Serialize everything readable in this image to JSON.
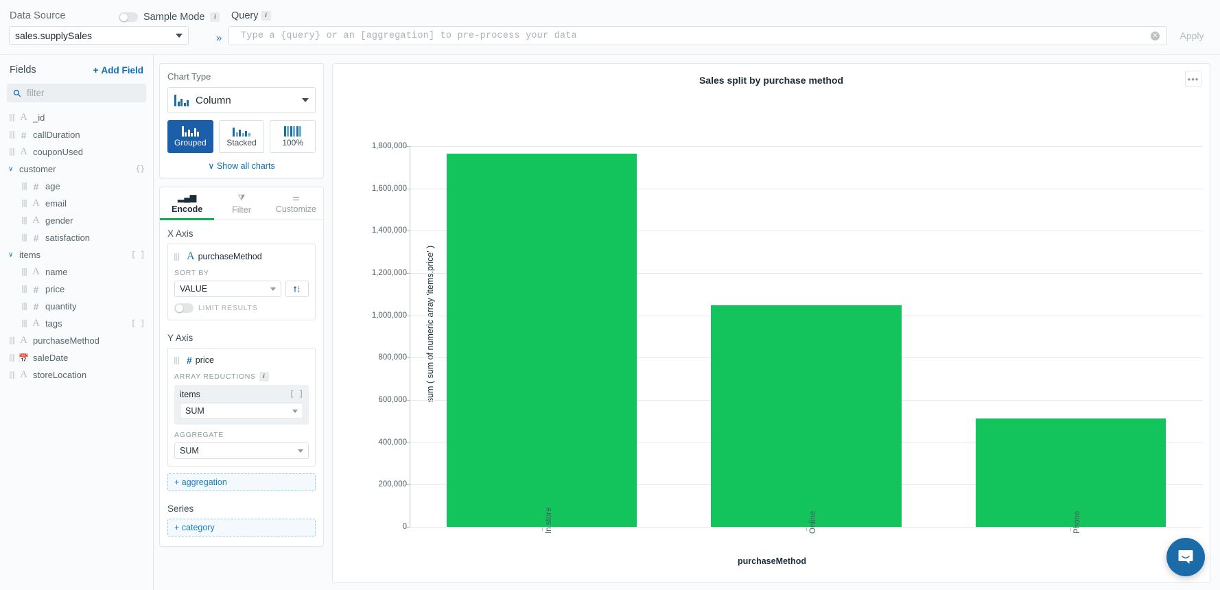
{
  "topbar": {
    "data_source_label": "Data Source",
    "sample_mode_label": "Sample Mode",
    "info_glyph": "i",
    "data_source_value": "sales.supplySales",
    "chevron_double": "»",
    "query_label": "Query",
    "query_value": "",
    "query_placeholder": "Type a {query} or an [aggregation] to pre-process your data",
    "clear_glyph": "✕",
    "apply_label": "Apply"
  },
  "sidebar": {
    "title": "Fields",
    "add_field_label": "Add Field",
    "add_field_plus": "+",
    "filter_placeholder": "filter",
    "search_glyph": "⚲",
    "fields": [
      {
        "name": "_id",
        "type": "A",
        "nested": false,
        "tag": ""
      },
      {
        "name": "callDuration",
        "type": "#",
        "nested": false,
        "tag": ""
      },
      {
        "name": "couponUsed",
        "type": "A",
        "nested": false,
        "tag": ""
      },
      {
        "name": "customer",
        "type": "group",
        "nested": false,
        "tag": "{}",
        "expanded": true
      },
      {
        "name": "age",
        "type": "#",
        "nested": true,
        "tag": ""
      },
      {
        "name": "email",
        "type": "A",
        "nested": true,
        "tag": ""
      },
      {
        "name": "gender",
        "type": "A",
        "nested": true,
        "tag": ""
      },
      {
        "name": "satisfaction",
        "type": "#",
        "nested": true,
        "tag": ""
      },
      {
        "name": "items",
        "type": "group",
        "nested": false,
        "tag": "[ ]",
        "expanded": true
      },
      {
        "name": "name",
        "type": "A",
        "nested": true,
        "tag": ""
      },
      {
        "name": "price",
        "type": "#",
        "nested": true,
        "tag": ""
      },
      {
        "name": "quantity",
        "type": "#",
        "nested": true,
        "tag": ""
      },
      {
        "name": "tags",
        "type": "A",
        "nested": true,
        "tag": "[ ]"
      },
      {
        "name": "purchaseMethod",
        "type": "A",
        "nested": false,
        "tag": ""
      },
      {
        "name": "saleDate",
        "type": "date",
        "nested": false,
        "tag": ""
      },
      {
        "name": "storeLocation",
        "type": "A",
        "nested": false,
        "tag": ""
      }
    ]
  },
  "chart_type_panel": {
    "title": "Chart Type",
    "selected_chart": "Column",
    "variants": [
      {
        "label": "Grouped",
        "active": true
      },
      {
        "label": "Stacked",
        "active": false
      },
      {
        "label": "100%",
        "active": false
      }
    ],
    "show_all_label": "Show all charts",
    "show_all_chevron": "∨"
  },
  "encode_panel": {
    "tabs": [
      {
        "label": "Encode",
        "icon": "bar-chart-icon",
        "active": true
      },
      {
        "label": "Filter",
        "icon": "funnel-icon",
        "active": false
      },
      {
        "label": "Customize",
        "icon": "sliders-icon",
        "active": false
      }
    ],
    "x_axis": {
      "heading": "X Axis",
      "field": "purchaseMethod",
      "field_type": "A",
      "sort_by_label": "SORT BY",
      "sort_by_value": "VALUE",
      "sort_direction_icon": "sort-asc-icon",
      "limit_results_label": "LIMIT RESULTS",
      "limit_results_on": false
    },
    "y_axis": {
      "heading": "Y Axis",
      "field": "price",
      "field_type": "#",
      "array_reductions_label": "ARRAY REDUCTIONS",
      "array_reduction_field": "items",
      "array_reduction_tag": "[ ]",
      "array_reduction_value": "SUM",
      "aggregate_label": "AGGREGATE",
      "aggregate_value": "SUM",
      "add_aggregation_label": "+ aggregation"
    },
    "series": {
      "heading": "Series",
      "add_category_label": "+ category"
    }
  },
  "chart_panel": {
    "menu_glyph": "•••",
    "chat_icon": "chat-bubble-icon"
  },
  "chart_data": {
    "type": "bar",
    "title": "Sales split by purchase method",
    "categories": [
      "In store",
      "Online",
      "Phone"
    ],
    "values": [
      1765000,
      1048000,
      512000
    ],
    "series": [
      {
        "name": "sum ( sum of numeric array 'items.price' )",
        "values": [
          1765000,
          1048000,
          512000
        ]
      }
    ],
    "xlabel": "purchaseMethod",
    "ylabel": "sum ( sum of numeric array 'items.price' )",
    "ylim": [
      0,
      1800000
    ],
    "yticks": [
      0,
      200000,
      400000,
      600000,
      800000,
      1000000,
      1200000,
      1400000,
      1600000,
      1800000
    ],
    "ytick_labels": [
      "0",
      "200,000",
      "400,000",
      "600,000",
      "800,000",
      "1,000,000",
      "1,200,000",
      "1,400,000",
      "1,600,000",
      "1,800,000"
    ],
    "bar_color": "#13c45d",
    "grid": true,
    "legend": "none",
    "xtick_rotation": -90
  }
}
